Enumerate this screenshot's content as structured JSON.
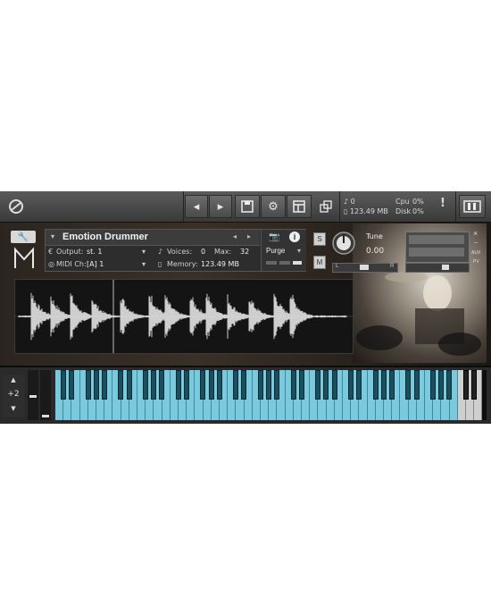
{
  "toolbar": {
    "voices": "0",
    "memory": "123.49 MB",
    "cpu_label": "Cpu",
    "cpu_value": "0%",
    "disk_label": "Disk",
    "disk_value": "0%",
    "alert": "!"
  },
  "instrument": {
    "name": "Emotion Drummer",
    "output_label": "Output:",
    "output_value": "st. 1",
    "midi_label": "MIDI Ch:",
    "midi_value": "[A]  1",
    "voices_label": "Voices:",
    "voices_value": "0",
    "max_label": "Max:",
    "max_value": "32",
    "memory_label": "Memory:",
    "memory_value": "123.49 MB",
    "purge_label": "Purge",
    "solo": "S",
    "mute": "M",
    "tune_label": "Tune",
    "tune_value": "0.00",
    "pan_left": "L",
    "pan_right": "R",
    "aux": "AUX",
    "pv": "PV"
  },
  "keyboard": {
    "octave": "+2",
    "key_color": "#7bc9dd"
  },
  "colors": {
    "toolbar": "#4a4a4a",
    "keys_active": "#7bc9dd",
    "keys_inactive": "#cfcfcf"
  }
}
